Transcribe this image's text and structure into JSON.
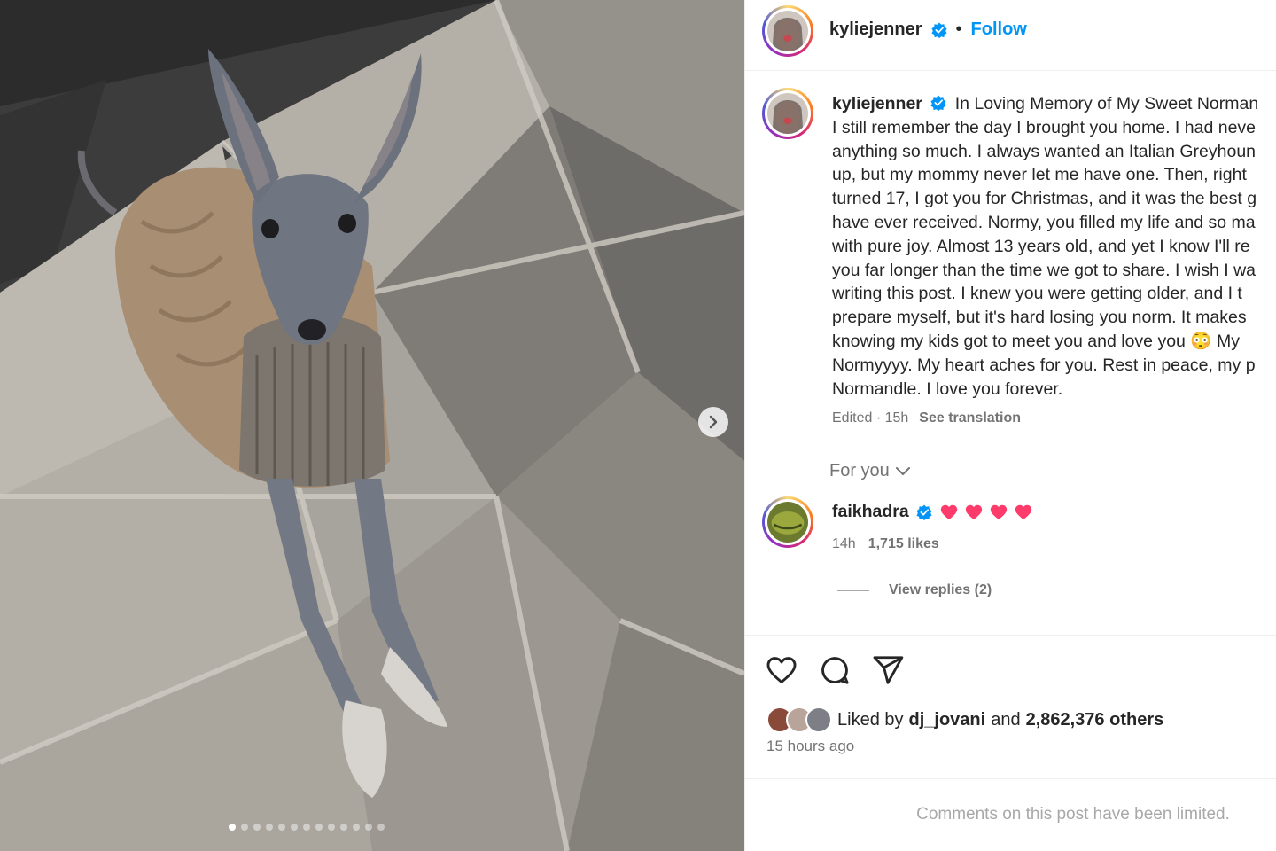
{
  "post": {
    "username": "kyliejenner",
    "follow_label": "Follow",
    "separator": "•",
    "verified_icon": "verified-badge-icon"
  },
  "caption": {
    "username": "kyliejenner",
    "lines": [
      "In Loving Memory of My Sweet Norman",
      "I still remember the day I brought you home. I had neve",
      "anything so much. I always wanted an Italian Greyhoun",
      "up, but my mommy never let me have one. Then, right",
      "turned 17, I got you for Christmas, and it was the best g",
      "have ever received. Normy, you filled my life and so ma",
      "with pure joy. Almost 13 years old, and yet I know I'll re",
      "you far longer than the time we got to share. I wish I wa",
      "writing this post. I knew you were getting older, and I t",
      "prepare myself, but it's hard losing you norm. It makes",
      "knowing my kids got to meet you and love you 😳 My",
      "Normyyyy. My heart aches for you. Rest in peace, my p",
      "Normandle. I love you forever."
    ],
    "edited": "Edited · 15h",
    "see_translation": "See translation"
  },
  "filter": {
    "label": "For you",
    "icon": "chevron-down-icon"
  },
  "comment": {
    "username": "faikhadra",
    "hearts": [
      "pink-heart",
      "pink-heart",
      "pink-heart",
      "pink-heart"
    ],
    "time": "14h",
    "likes": "1,715 likes",
    "view_replies": "View replies (2)"
  },
  "actions": {
    "icons": [
      "heart-icon",
      "comment-icon",
      "share-icon"
    ]
  },
  "likes": {
    "prefix": "Liked by",
    "user": "dj_jovani",
    "middle": "and",
    "count": "2,862,376 others"
  },
  "time_ago": "15 hours ago",
  "comments_limited": "Comments on this post have been limited.",
  "carousel": {
    "slide_count": 13,
    "active_index": 0
  },
  "colors": {
    "follow": "#0095f6",
    "verified": "#0095f6",
    "heart": "#ff3b6b",
    "secondary_text": "#737373"
  }
}
